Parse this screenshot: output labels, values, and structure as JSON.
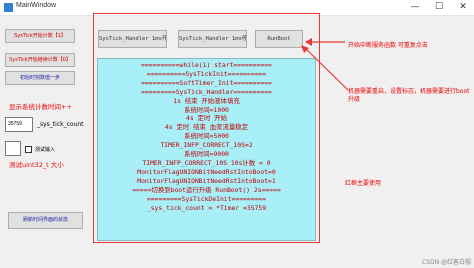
{
  "window": {
    "title": "MainWindow",
    "minimize_glyph": "—",
    "maximize_glyph": "☐",
    "close_glyph": "✕"
  },
  "left_panel": {
    "btn_systick_start": "SysTick开始计数【1】",
    "btn_systick_restart": "SysTick开始继续计数【0】",
    "btn_reset_count": "初始时刻数值一步",
    "label_timer_note": "显示系统计数时间++",
    "input_tick_value": "35759",
    "label_sys_tick_count": "_sys_tick_count",
    "input_test": "",
    "label_test_input": "测试输入",
    "label_uint32_size": "测试uint32_t 大小",
    "btn_refresh_state": "刷新时间界面的状态"
  },
  "toolbar": {
    "btn_systick_handler_on": "SysTick_Handler 1ms开始",
    "btn_systick_handler_off": "SysTick_Handler 1ms停止",
    "btn_run_boot": "RunBoot"
  },
  "log_lines": [
    "==========while(1) start==========",
    "==========SysTickInit==========",
    "==========SoftTimer_Init==========",
    "=========SysTick_Handler==========",
    "1s 结束 开始液体填充",
    "系统时间=1000",
    "4s 定时 开始",
    "4s 定时 结束 血浆流量稳定",
    "系统时间=5000",
    "TIMER_INFP_CORRECT_10S=2",
    "系统时间=9000",
    "TIMER_INFP_CORRECT_10S 10s计数 = 0",
    "MonitorFlagUNIONBitNeedRstIntoBoot=0",
    "MonitorFlagUNIONBitNeedRstIntoBoot=1",
    "=====切换到boot运行升级 RunBoot() 2s=====",
    "=========SysTickDeInit=========",
    "_sys_tick_count = *Timer =35759"
  ],
  "annotations": {
    "start_interrupt": "开始中断服务函数 可重复点击",
    "reboot_note": "机器需要重启，设置标志，机器需要进行boot升级",
    "red_frame_note": "红框主要使用"
  },
  "watermark": "CSDN @红客白帽",
  "colors": {
    "log_bg": "#a8eff8",
    "log_text": "#c00000",
    "annotation": "#ee0000",
    "frame": "#e53935"
  }
}
